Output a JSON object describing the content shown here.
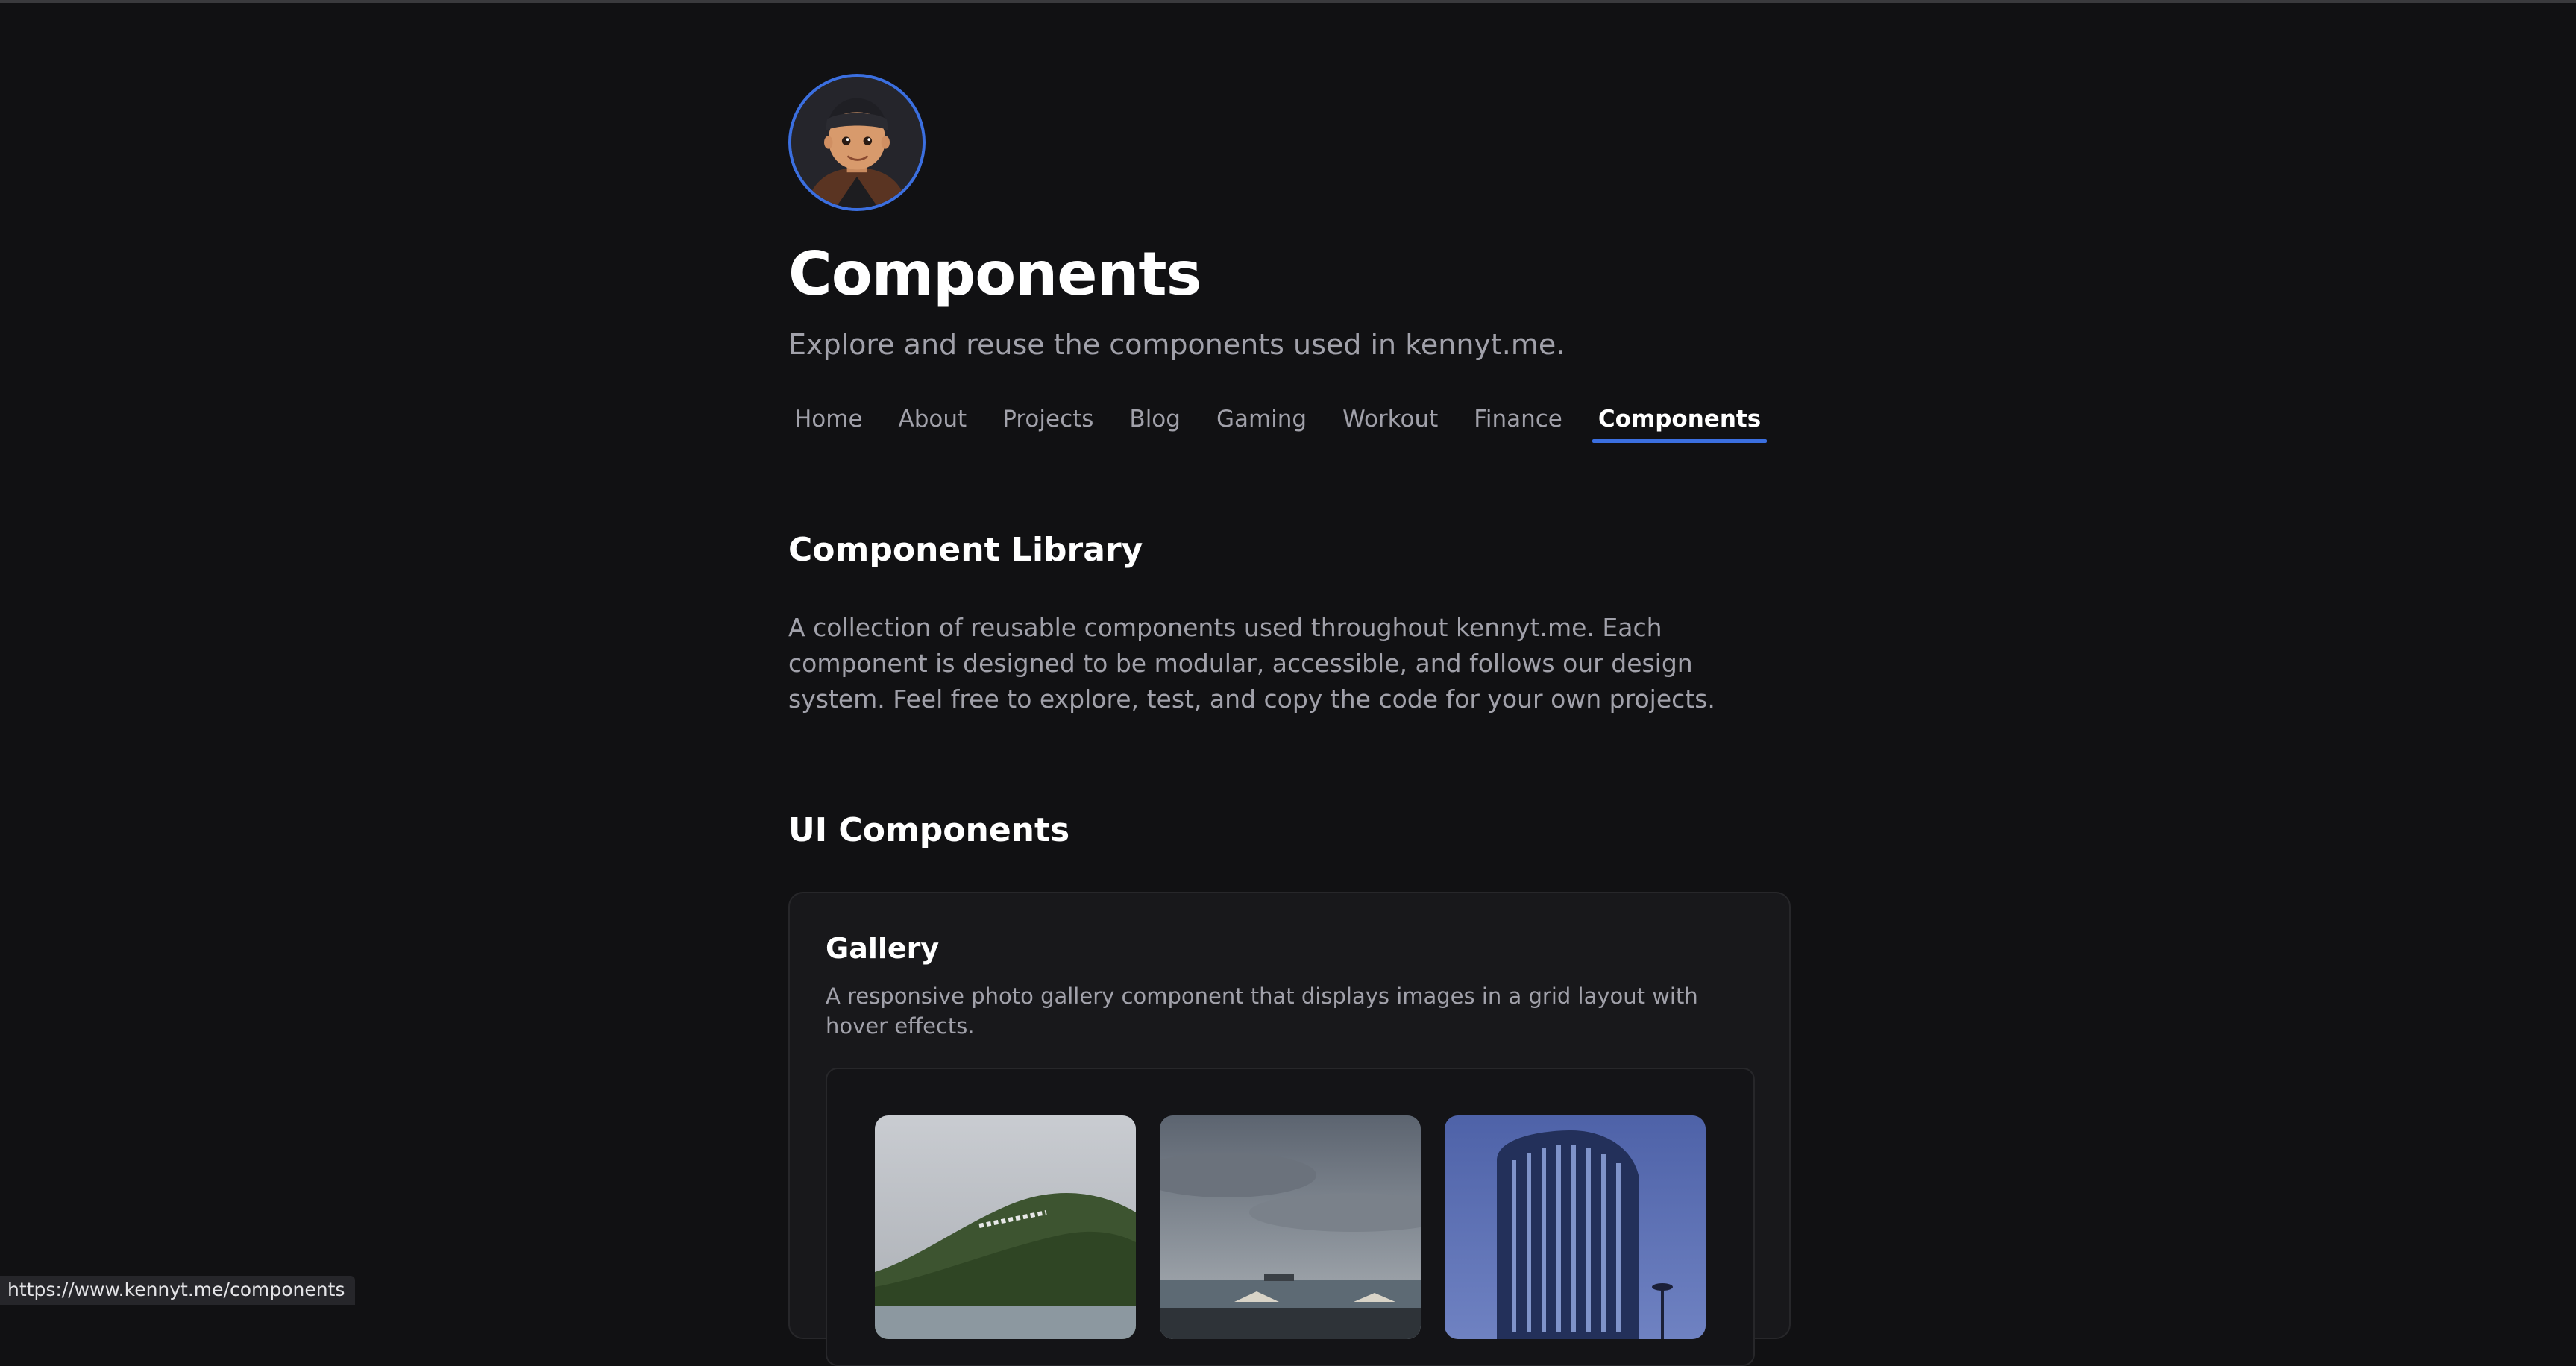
{
  "page": {
    "title": "Components",
    "subtitle": "Explore and reuse the components used in kennyt.me."
  },
  "avatar": {
    "icon": "avatar-illustration"
  },
  "nav": {
    "items": [
      {
        "label": "Home"
      },
      {
        "label": "About"
      },
      {
        "label": "Projects"
      },
      {
        "label": "Blog"
      },
      {
        "label": "Gaming"
      },
      {
        "label": "Workout"
      },
      {
        "label": "Finance"
      },
      {
        "label": "Components"
      }
    ],
    "active": "Components"
  },
  "library": {
    "heading": "Component Library",
    "description": "A collection of reusable components used throughout kennyt.me. Each component is designed to be modular, accessible, and follows our design system. Feel free to explore, test, and copy the code for your own projects."
  },
  "ui_components": {
    "heading": "UI Components",
    "gallery": {
      "title": "Gallery",
      "description": "A responsive photo gallery component that displays images in a grid layout with hover effects.",
      "photos": [
        {
          "name": "hillside-coast"
        },
        {
          "name": "beach-cloudy-sky"
        },
        {
          "name": "hotel-tower"
        }
      ]
    }
  },
  "status_bar": {
    "url": "https://www.kennyt.me/components"
  },
  "colors": {
    "background": "#111113",
    "accent": "#3b6fe0",
    "muted_text": "#a1a1aa"
  }
}
